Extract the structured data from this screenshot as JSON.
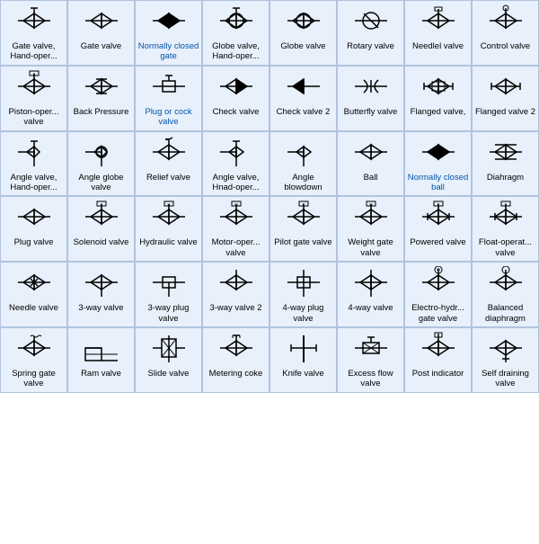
{
  "cells": [
    {
      "label": "Gate valve,\nHand-oper...",
      "svg": "gate_hand"
    },
    {
      "label": "Gate valve",
      "svg": "gate"
    },
    {
      "label": "Normally\nclosed gate",
      "svg": "norm_closed_gate",
      "blue": true
    },
    {
      "label": "Globe valve,\nHand-oper...",
      "svg": "globe_hand"
    },
    {
      "label": "Globe valve",
      "svg": "globe"
    },
    {
      "label": "Rotary valve",
      "svg": "rotary"
    },
    {
      "label": "Needlel valve",
      "svg": "needle1"
    },
    {
      "label": "Control valve",
      "svg": "control"
    },
    {
      "label": "Piston-oper...\nvalve",
      "svg": "piston"
    },
    {
      "label": "Back\nPressure",
      "svg": "back_pressure"
    },
    {
      "label": "Plug or cock\nvalve",
      "svg": "plug_cock",
      "blue": true
    },
    {
      "label": "Check valve",
      "svg": "check"
    },
    {
      "label": "Check valve\n2",
      "svg": "check2"
    },
    {
      "label": "Butterfly\nvalve",
      "svg": "butterfly"
    },
    {
      "label": "Flanged\nvalve,",
      "svg": "flanged"
    },
    {
      "label": "Flanged\nvalve 2",
      "svg": "flanged2"
    },
    {
      "label": "Angle valve,\nHand-oper...",
      "svg": "angle_hand"
    },
    {
      "label": "Angle globe\nvalve",
      "svg": "angle_globe"
    },
    {
      "label": "Relief valve",
      "svg": "relief"
    },
    {
      "label": "Angle valve,\nHnad-oper...",
      "svg": "angle_hand2"
    },
    {
      "label": "Angle\nblowdown",
      "svg": "angle_blow"
    },
    {
      "label": "Ball",
      "svg": "ball"
    },
    {
      "label": "Normally\nclosed ball",
      "svg": "norm_closed_ball",
      "blue": true
    },
    {
      "label": "Diahragm",
      "svg": "diaphragm"
    },
    {
      "label": "Plug valve",
      "svg": "plug"
    },
    {
      "label": "Solenoid\nvalve",
      "svg": "solenoid"
    },
    {
      "label": "Hydraulic\nvalve",
      "svg": "hydraulic"
    },
    {
      "label": "Motor-oper...\nvalve",
      "svg": "motor"
    },
    {
      "label": "Pilot gate\nvalve",
      "svg": "pilot_gate"
    },
    {
      "label": "Weight gate\nvalve",
      "svg": "weight_gate"
    },
    {
      "label": "Powered\nvalve",
      "svg": "powered"
    },
    {
      "label": "Float-operat...\nvalve",
      "svg": "float"
    },
    {
      "label": "Needle valve",
      "svg": "needle_v"
    },
    {
      "label": "3-way valve",
      "svg": "three_way"
    },
    {
      "label": "3-way plug\nvalve",
      "svg": "three_plug"
    },
    {
      "label": "3-way valve 2",
      "svg": "three_way2"
    },
    {
      "label": "4-way plug\nvalve",
      "svg": "four_plug"
    },
    {
      "label": "4-way valve",
      "svg": "four_way"
    },
    {
      "label": "Electro-hydr...\ngate valve",
      "svg": "electro_hydr"
    },
    {
      "label": "Balanced\ndiaphragm",
      "svg": "balanced_dia"
    },
    {
      "label": "Spring gate\nvalve",
      "svg": "spring_gate"
    },
    {
      "label": "Ram valve",
      "svg": "ram"
    },
    {
      "label": "Slide valve",
      "svg": "slide"
    },
    {
      "label": "Metering\ncoke",
      "svg": "metering"
    },
    {
      "label": "Knife valve",
      "svg": "knife"
    },
    {
      "label": "Excess flow\nvalve",
      "svg": "excess_flow"
    },
    {
      "label": "Post\nindicator",
      "svg": "post_ind"
    },
    {
      "label": "Self draining\nvalve",
      "svg": "self_drain"
    }
  ]
}
